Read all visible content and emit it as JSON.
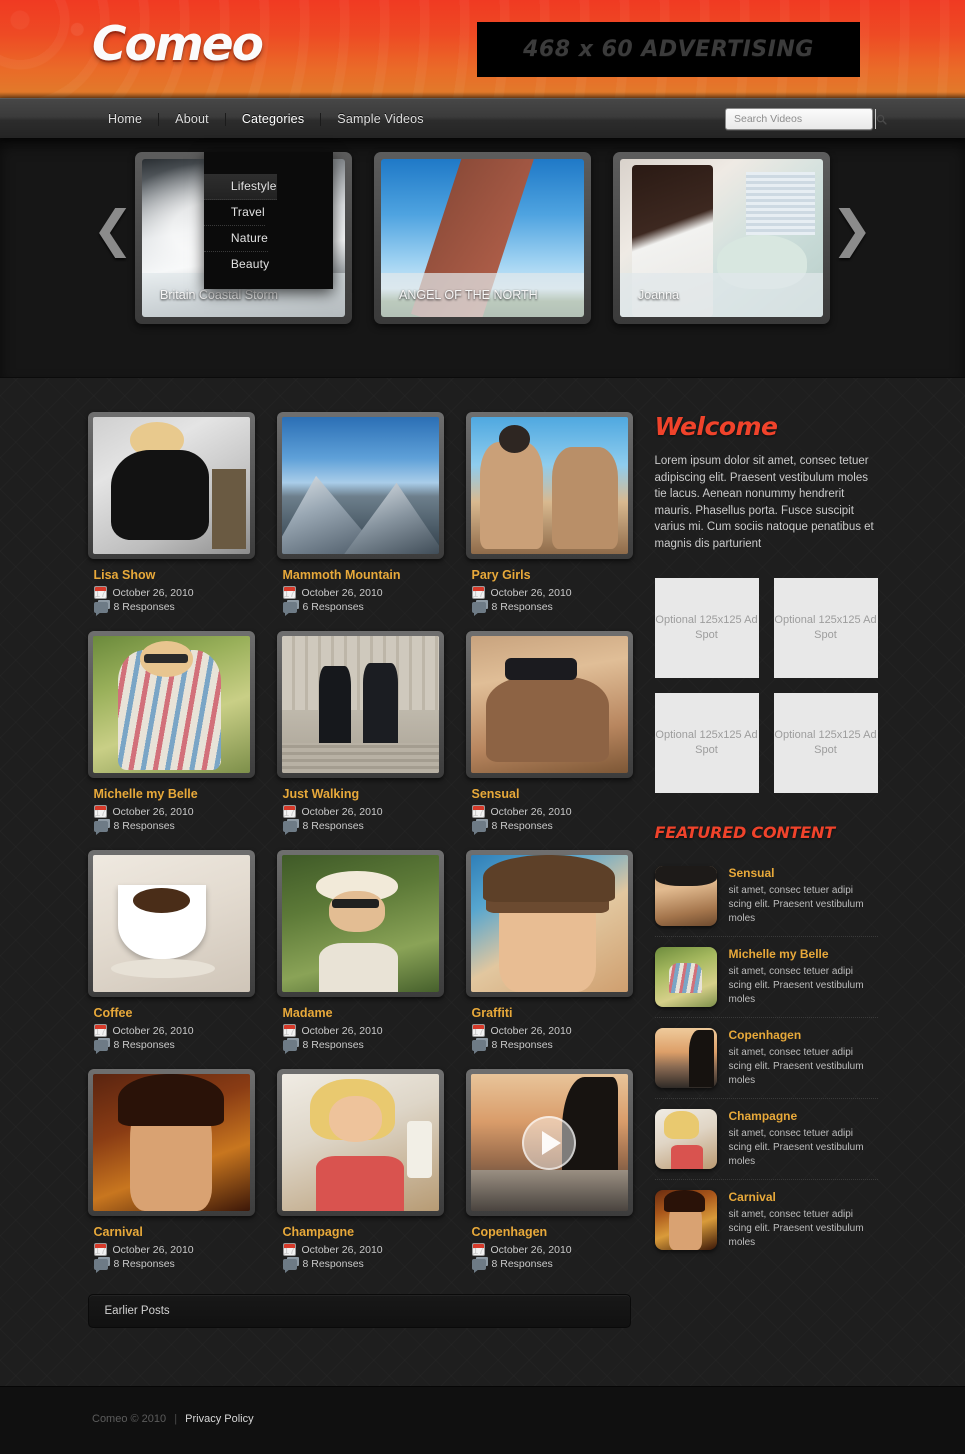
{
  "site": {
    "logo": "Comeo"
  },
  "header": {
    "ad_banner_label": "468 x 60 ADVERTISING"
  },
  "nav": {
    "items": [
      {
        "label": "Home"
      },
      {
        "label": "About"
      },
      {
        "label": "Categories"
      },
      {
        "label": "Sample Videos"
      }
    ],
    "dropdown": [
      {
        "label": "Lifestyle"
      },
      {
        "label": "Travel"
      },
      {
        "label": "Nature"
      },
      {
        "label": "Beauty"
      }
    ]
  },
  "search": {
    "placeholder": "Search Videos",
    "value": "",
    "icon": "search-icon"
  },
  "slider": {
    "prev_icon": "chevron-left-icon",
    "next_icon": "chevron-right-icon",
    "slides": [
      {
        "caption": "Britain Coastal Storm"
      },
      {
        "caption": "ANGEL OF THE NORTH"
      },
      {
        "caption": "Joanna"
      }
    ]
  },
  "posts": [
    {
      "title": "Lisa Show",
      "date": "October 26, 2010",
      "responses": "8 Responses",
      "video": false
    },
    {
      "title": "Mammoth Mountain",
      "date": "October 26, 2010",
      "responses": "6 Responses",
      "video": false
    },
    {
      "title": "Pary Girls",
      "date": "October 26, 2010",
      "responses": "8 Responses",
      "video": false
    },
    {
      "title": "Michelle my Belle",
      "date": "October 26, 2010",
      "responses": "8 Responses",
      "video": false
    },
    {
      "title": "Just Walking",
      "date": "October 26, 2010",
      "responses": "8 Responses",
      "video": false
    },
    {
      "title": "Sensual",
      "date": "October 26, 2010",
      "responses": "8 Responses",
      "video": false
    },
    {
      "title": "Coffee",
      "date": "October 26, 2010",
      "responses": "8 Responses",
      "video": false
    },
    {
      "title": "Madame",
      "date": "October 26, 2010",
      "responses": "8 Responses",
      "video": false
    },
    {
      "title": "Graffiti",
      "date": "October 26, 2010",
      "responses": "8 Responses",
      "video": false
    },
    {
      "title": "Carnival",
      "date": "October 26, 2010",
      "responses": "8 Responses",
      "video": false
    },
    {
      "title": "Champagne",
      "date": "October 26, 2010",
      "responses": "8 Responses",
      "video": false
    },
    {
      "title": "Copenhagen",
      "date": "October 26, 2010",
      "responses": "8 Responses",
      "video": true
    }
  ],
  "pagination": {
    "earlier_label": "Earlier Posts"
  },
  "sidebar": {
    "welcome_title": "Welcome",
    "welcome_text": "Lorem ipsum dolor sit amet, consec tetuer adipiscing elit. Praesent vestibulum moles tie lacus. Aenean nonummy hendrerit mauris. Phasellus porta. Fusce suscipit varius mi. Cum sociis natoque penatibus et magnis dis parturient",
    "ads": [
      {
        "label": "Optional 125x125 Ad Spot"
      },
      {
        "label": "Optional 125x125 Ad Spot"
      },
      {
        "label": "Optional 125x125 Ad Spot"
      },
      {
        "label": "Optional 125x125 Ad Spot"
      }
    ],
    "featured_title": "FEATURED CONTENT",
    "featured": [
      {
        "title": "Sensual",
        "desc": "sit amet, consec tetuer adipi scing elit. Praesent vestibulum moles"
      },
      {
        "title": "Michelle my Belle",
        "desc": "sit amet, consec tetuer adipi scing elit. Praesent vestibulum moles"
      },
      {
        "title": "Copenhagen",
        "desc": "sit amet, consec tetuer adipi scing elit. Praesent vestibulum moles"
      },
      {
        "title": "Champagne",
        "desc": "sit amet, consec tetuer adipi scing elit. Praesent vestibulum moles"
      },
      {
        "title": "Carnival",
        "desc": "sit amet, consec tetuer adipi scing elit. Praesent vestibulum moles"
      }
    ]
  },
  "footer": {
    "copyright": "Comeo © 2010",
    "separator": "|",
    "privacy": "Privacy Policy"
  },
  "colors": {
    "brand_orange": "#f0432b",
    "title_gold": "#e8a93a",
    "header_top": "#f03a22",
    "header_bottom": "#e07d2b"
  }
}
